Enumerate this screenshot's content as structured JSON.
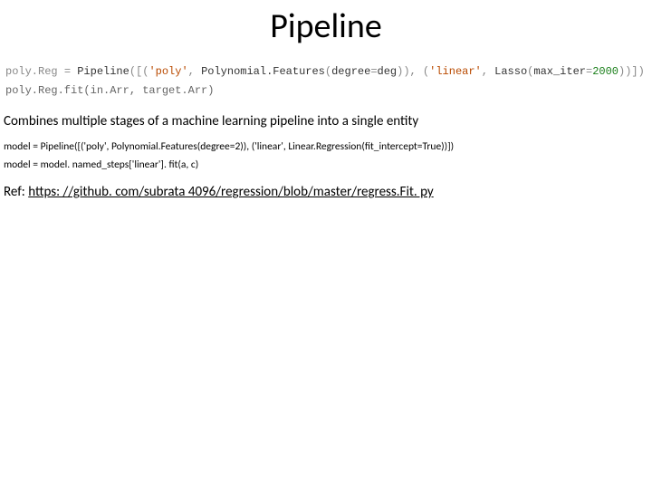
{
  "title": "Pipeline",
  "code": {
    "line1": {
      "p1": "poly.Reg ",
      "eq": "= ",
      "fn": "Pipeline",
      "open": "([(",
      "s1": "'poly'",
      "c1": ", ",
      "id1": "Polynomial.Features",
      "o2": "(",
      "kw1": "degree",
      "eq2": "=",
      "v1": "deg",
      "c2": ")), (",
      "s2": "'linear'",
      "c3": ", ",
      "id2": "Lasso",
      "o3": "(",
      "kw2": "max_iter",
      "eq3": "=",
      "v2": "2000",
      "close": "))])"
    },
    "line2": "poly.Reg.fit(in.Arr, target.Arr)"
  },
  "description": "Combines multiple stages of a machine learning pipeline into a single entity",
  "example": {
    "l1": "model = Pipeline([('poly', Polynomial.Features(degree=2)), ('linear', Linear.Regression(fit_intercept=True))])",
    "l2": "model = model. named_steps['linear']. fit(a, c)"
  },
  "ref": {
    "prefix": "Ref: ",
    "url": "https: //github. com/subrata 4096/regression/blob/master/regress.Fit. py"
  }
}
